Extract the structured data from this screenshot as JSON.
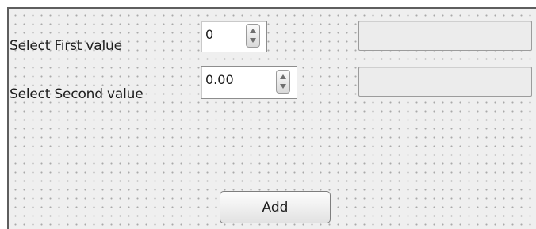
{
  "form": {
    "first_label": "Select First value",
    "second_label": "Select Second value",
    "first_spinbox": {
      "value": "0"
    },
    "second_spinbox": {
      "value": "0.00"
    },
    "first_result": {
      "value": ""
    },
    "second_result": {
      "value": ""
    },
    "add_button_label": "Add"
  }
}
